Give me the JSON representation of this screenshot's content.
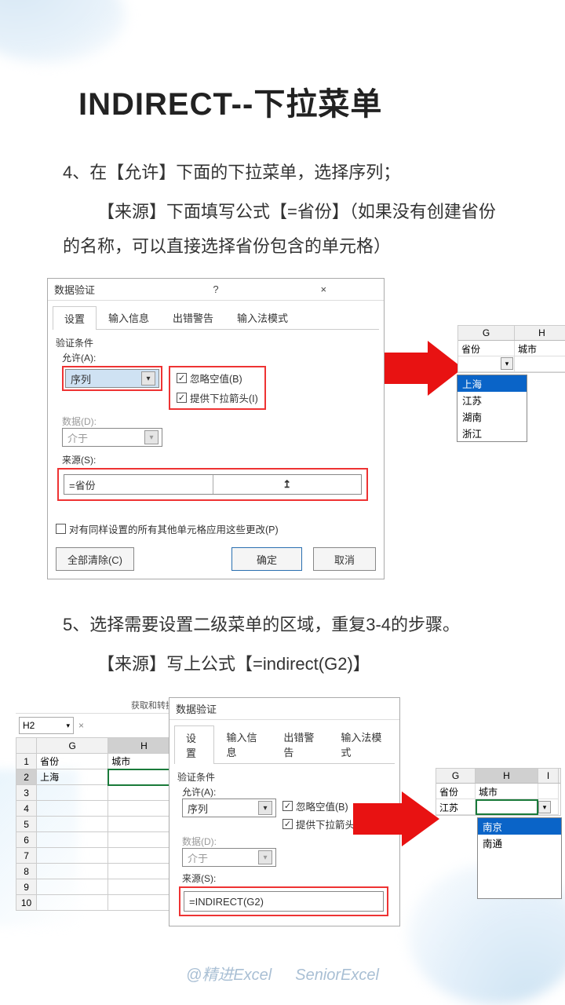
{
  "title": "INDIRECT--下拉菜单",
  "step4": {
    "line1": "4、在【允许】下面的下拉菜单，选择序列；",
    "line2": "【来源】下面填写公式【=省份】（如果没有创建省份的名称，可以直接选择省份包含的单元格）"
  },
  "step5": {
    "line1": "5、选择需要设置二级菜单的区域，重复3-4的步骤。",
    "line2": "【来源】写上公式【=indirect(G2)】"
  },
  "dialog": {
    "title": "数据验证",
    "help": "?",
    "close": "×",
    "tabs": [
      "设置",
      "输入信息",
      "出错警告",
      "输入法模式"
    ],
    "group": "验证条件",
    "allow_label": "允许(A):",
    "allow_value": "序列",
    "ignore_blank": "忽略空值(B)",
    "show_dropdown": "提供下拉箭头(I)",
    "data_label": "数据(D):",
    "data_value": "介于",
    "source_label": "来源(S):",
    "source_value1": "=省份",
    "source_value2": "=INDIRECT(G2)",
    "apply_others": "对有同样设置的所有其他单元格应用这些更改(P)",
    "clear": "全部清除(C)",
    "ok": "确定",
    "cancel": "取消",
    "ref_symbol": "↥"
  },
  "xl1": {
    "cols": [
      "G",
      "H"
    ],
    "headers": [
      "省份",
      "城市"
    ],
    "dropdown_items": [
      "上海",
      "江苏",
      "湖南",
      "浙江"
    ],
    "selected": "上海"
  },
  "mini_xl": {
    "ribbon": "获取和转换",
    "namebox": "H2",
    "cols": [
      "G",
      "H"
    ],
    "rows": [
      "1",
      "2",
      "3",
      "4",
      "5",
      "6",
      "7",
      "8",
      "9",
      "10"
    ],
    "r1": [
      "省份",
      "城市"
    ],
    "r2": [
      "上海",
      ""
    ]
  },
  "xl2": {
    "cols": [
      "G",
      "H",
      "I"
    ],
    "headers": [
      "省份",
      "城市"
    ],
    "r2_g": "江苏",
    "dropdown_items": [
      "南京",
      "南通"
    ],
    "selected": "南京"
  },
  "footer": {
    "cn": "@精进Excel",
    "en": "SeniorExcel"
  },
  "icons": {
    "caret": "▾",
    "x": "×",
    "check": "✓"
  }
}
